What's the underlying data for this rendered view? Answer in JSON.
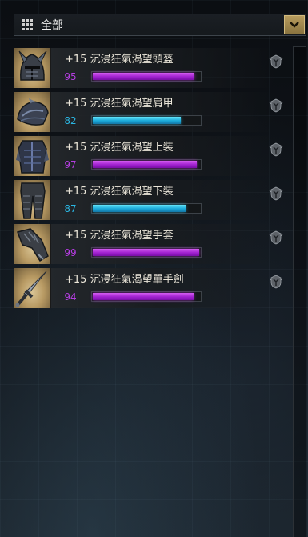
{
  "filter": {
    "label": "全部",
    "icon": "grid-menu-icon",
    "dropdown_icon": "chevron-down-icon"
  },
  "colors": {
    "purple": "#b43de0",
    "blue": "#2bb7e3",
    "gold": "#b79c5e"
  },
  "items": [
    {
      "name": "+15 沉浸狂氣渴望頭盔",
      "score": "95",
      "level": 0.95,
      "tier": "purple",
      "icon": "helmet-icon"
    },
    {
      "name": "+15 沉浸狂氣渴望肩甲",
      "score": "82",
      "level": 0.82,
      "tier": "blue",
      "icon": "pauldron-icon"
    },
    {
      "name": "+15 沉浸狂氣渴望上裝",
      "score": "97",
      "level": 0.97,
      "tier": "purple",
      "icon": "chest-armor-icon"
    },
    {
      "name": "+15 沉浸狂氣渴望下裝",
      "score": "87",
      "level": 0.87,
      "tier": "blue",
      "icon": "leg-armor-icon"
    },
    {
      "name": "+15 沉浸狂氣渴望手套",
      "score": "99",
      "level": 0.99,
      "tier": "purple",
      "icon": "gloves-icon"
    },
    {
      "name": "+15 沉浸狂氣渴望單手劍",
      "score": "94",
      "level": 0.94,
      "tier": "purple",
      "icon": "sword-icon"
    }
  ]
}
